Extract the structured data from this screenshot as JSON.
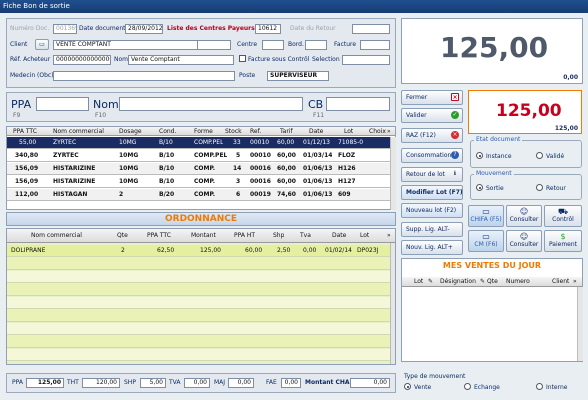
{
  "window": {
    "title": "Fiche Bon de sortie"
  },
  "header": {
    "numero_doc_label": "Numéro Doc.",
    "numero_doc_value": "001369",
    "date_doc_label": "Date document",
    "date_doc_value": "28/09/2012",
    "centres_label": "Liste des Centres Payeurs",
    "centres_value": "10612",
    "date_retour_label": "Date du Retour",
    "date_retour_value": "",
    "client_label": "Client",
    "client_value": "VENTE COMPTANT",
    "centre_label": "Centre",
    "centre_value": "",
    "bord_label": "Bord.",
    "bord_value": "",
    "facture_label": "Facture",
    "facture_value": "",
    "ref_acheteur_label": "Réf. Acheteur",
    "ref_acheteur_value": "0000000000000000",
    "nom_label": "Nom",
    "nom_value": "Vente Comptant",
    "facture_sous_label": "Facture sous Contrôl",
    "selection_label": "Selection",
    "selection_value": "",
    "medecin_label": "Medecin (Obc)",
    "medecin_value": "",
    "poste_label": "Poste",
    "poste_value": "SUPERVISEUR"
  },
  "search": {
    "ppa_label": "PPA",
    "nom_label": "Nom",
    "cb_label": "CB",
    "f9": "F9",
    "f10": "F10",
    "f11": "F11"
  },
  "products": {
    "headers": [
      "PPA TTC",
      "Nom commercial",
      "Dosage",
      "Cond.",
      "Forme",
      "Stock",
      "Ref.",
      "Tarif",
      "Date",
      "Lot",
      "Choix"
    ],
    "rows": [
      [
        "55,00",
        "ZYRTEC",
        "10MG",
        "B/10",
        "COMP.PEL",
        "33",
        "00010",
        "60,00",
        "01/12/13",
        "71085-0",
        ""
      ],
      [
        "340,80",
        "ZYRTEC",
        "10MG",
        "B/10",
        "COMP.PEL",
        "5",
        "00010",
        "60,00",
        "01/03/14",
        "FLOZ",
        ""
      ],
      [
        "156,09",
        "HISTARIZINE",
        "10MG",
        "B/10",
        "COMP.",
        "14",
        "00016",
        "60,00",
        "01/06/13",
        "H126",
        ""
      ],
      [
        "156,09",
        "HISTARIZINE",
        "10MG",
        "B/10",
        "COMP.",
        "3",
        "00016",
        "60,00",
        "01/06/13",
        "H127",
        ""
      ],
      [
        "112,00",
        "HISTAGAN",
        "2",
        "B/20",
        "COMP.",
        "6",
        "00019",
        "74,60",
        "01/06/13",
        "609",
        ""
      ]
    ]
  },
  "ordonnance": {
    "title": "ORDONNANCE",
    "headers": [
      "Nom commercial",
      "Qte",
      "PPA TTC",
      "Montant",
      "PPA HT",
      "Shp",
      "Tva",
      "Date",
      "Lot"
    ],
    "rows": [
      [
        "DOLIPRANE",
        "2",
        "62,50",
        "125,00",
        "60,00",
        "2,50",
        "0,00",
        "01/02/14",
        "DP023J"
      ]
    ]
  },
  "totals": {
    "ppa_label": "PPA",
    "ppa_value": "125,00",
    "tht_label": "THT",
    "tht_value": "120,00",
    "shp_label": "SHP",
    "shp_value": "5,00",
    "tva_label": "TVA",
    "tva_value": "0,00",
    "maj_label": "MAJ",
    "maj_value": "0,00",
    "fae_label": "FAE",
    "fae_value": "0,00",
    "montant_label": "Montant CHASS",
    "montant_value": "0,00"
  },
  "display": {
    "big_total": "125,00",
    "big_small": "0,00",
    "red_total": "125,00",
    "red_small": "125,00"
  },
  "buttons": {
    "fermer": "Fermer",
    "valider": "Valider",
    "raz": "RAZ (F12)",
    "consommation": "Consommation",
    "retour_lot": "Retour de lot",
    "modifier_lot": "Modifier Lot (F7)",
    "nouveau_lot": "Nouveau lot (F2)",
    "supp_lig": "Supp. Lig. ALT-",
    "nouv_lig": "Nouv. Lig. ALT+",
    "chifa": "CHIFA (F5)",
    "consulter1": "Consulter",
    "controle": "Contrôl",
    "cm": "CM (F6)",
    "consulter2": "Consulter",
    "paiement": "Paiement"
  },
  "etat": {
    "title": "Etat document",
    "instance": "Instance",
    "valide": "Validé"
  },
  "mouvement": {
    "title": "Mouvement",
    "sortie": "Sortie",
    "retour": "Retour"
  },
  "ventes": {
    "title": "MES VENTES DU JOUR",
    "headers": [
      "Lot",
      "Désignation",
      "Qte",
      "Numero",
      "Client"
    ]
  },
  "type_mouvement": {
    "title": "Type de mouvement",
    "vente": "Vente",
    "echange": "Echange",
    "interne": "Interne"
  },
  "colors": {
    "accent": "#1b2b63",
    "red": "#c8001e",
    "orange": "#f07a00",
    "green_grid": "#eaf2b8"
  }
}
